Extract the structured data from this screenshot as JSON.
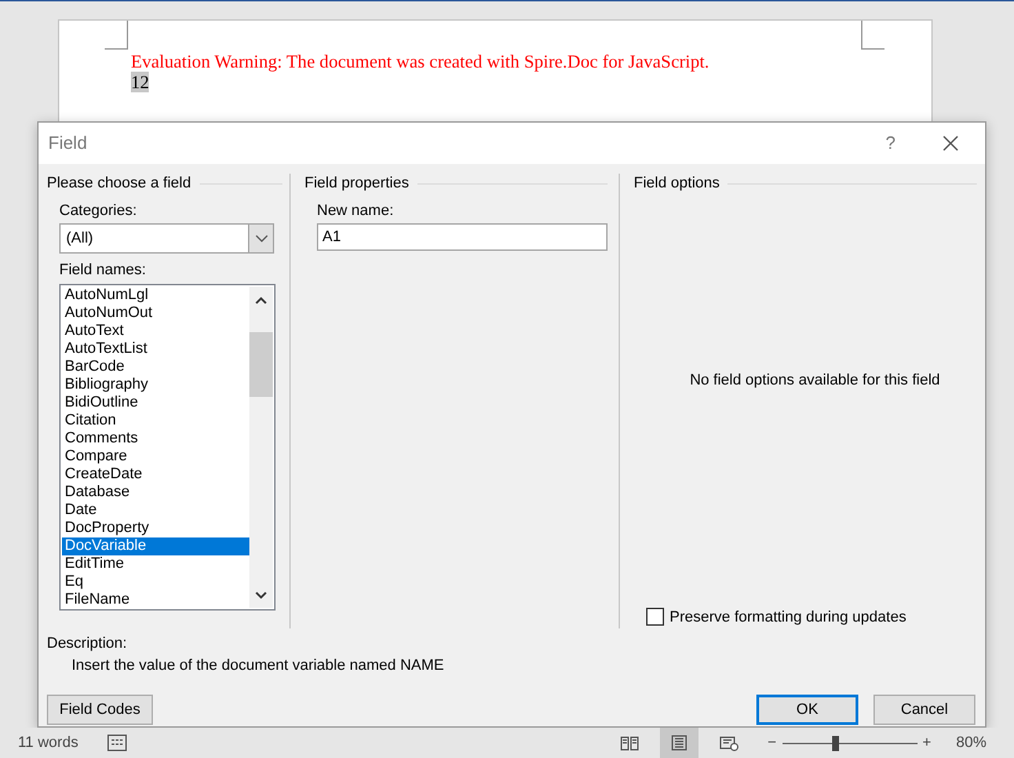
{
  "document": {
    "warning": "Evaluation Warning: The document was created with Spire.Doc for JavaScript.",
    "field_result": "12"
  },
  "dialog": {
    "title": "Field",
    "help": "?",
    "choose": {
      "heading": "Please choose a field",
      "categories_label": "Categories:",
      "category_value": "(All)",
      "field_names_label": "Field names:",
      "field_names": [
        {
          "label": "AutoNumLgl",
          "selected": false
        },
        {
          "label": "AutoNumOut",
          "selected": false
        },
        {
          "label": "AutoText",
          "selected": false
        },
        {
          "label": "AutoTextList",
          "selected": false
        },
        {
          "label": "BarCode",
          "selected": false
        },
        {
          "label": "Bibliography",
          "selected": false
        },
        {
          "label": "BidiOutline",
          "selected": false
        },
        {
          "label": "Citation",
          "selected": false
        },
        {
          "label": "Comments",
          "selected": false
        },
        {
          "label": "Compare",
          "selected": false
        },
        {
          "label": "CreateDate",
          "selected": false
        },
        {
          "label": "Database",
          "selected": false
        },
        {
          "label": "Date",
          "selected": false
        },
        {
          "label": "DocProperty",
          "selected": false
        },
        {
          "label": "DocVariable",
          "selected": true
        },
        {
          "label": "EditTime",
          "selected": false
        },
        {
          "label": "Eq",
          "selected": false
        },
        {
          "label": "FileName",
          "selected": false
        }
      ]
    },
    "properties": {
      "heading": "Field properties",
      "new_name_label": "New name:",
      "new_name_value": "A1"
    },
    "options": {
      "heading": "Field options",
      "empty_message": "No field options available for this field",
      "preserve": {
        "label": "Preserve formatting during updates",
        "checked": false
      }
    },
    "description": {
      "label": "Description:",
      "text": "Insert the value of the document variable named NAME"
    },
    "field_codes_button": "Field Codes",
    "buttons": [
      {
        "label": "OK",
        "default": true
      },
      {
        "label": "Cancel",
        "default": false
      }
    ]
  },
  "status_bar": {
    "word_count": "11 words",
    "views": [
      {
        "kind": "read",
        "selected": false
      },
      {
        "kind": "print",
        "selected": true
      },
      {
        "kind": "web",
        "selected": false
      }
    ],
    "zoom": {
      "minus": "−",
      "plus": "+",
      "level": 0.39,
      "reading": "80%"
    }
  }
}
